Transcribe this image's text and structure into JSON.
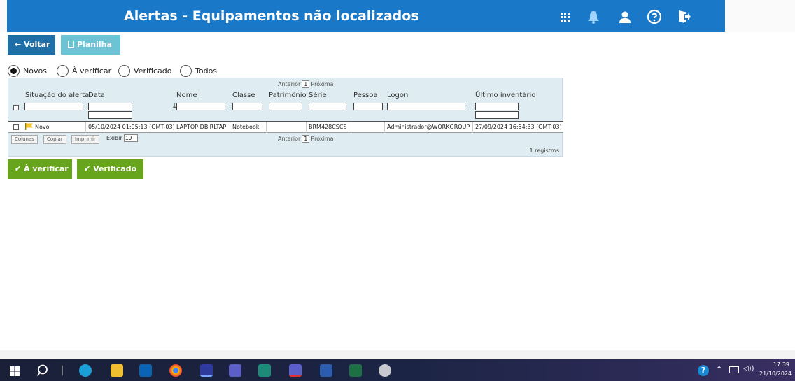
{
  "header": {
    "title": "Alertas - Equipamentos não localizados",
    "bar_color": "#1978c8",
    "icons": [
      "apps-grid-icon",
      "bell-icon",
      "user-icon",
      "help-icon",
      "logout-icon"
    ]
  },
  "toolbar": {
    "back_label": "← Voltar",
    "spreadsheet_label": "Planilha"
  },
  "filters": {
    "options": [
      "Novos",
      "À verificar",
      "Verificado",
      "Todos"
    ],
    "selected": "Novos"
  },
  "grid": {
    "pager": {
      "prev": "Anterior",
      "page": "1",
      "next": "Próxima"
    },
    "columns": [
      "Situação do alerta",
      "Data",
      "Nome",
      "Classe",
      "Patrimônio",
      "Série",
      "Pessoa",
      "Logon",
      "Último inventário"
    ],
    "sort_indicator": "↓",
    "rows": [
      {
        "status": "Novo",
        "data": "05/10/2024 01:05:13 (GMT-03)",
        "nome": "LAPTOP-DBIRLTAP",
        "classe": "Notebook",
        "patrimonio": "",
        "serie": "BRM428CSCS",
        "pessoa": "",
        "logon": "Administrador@WORKGROUP",
        "ultimo_inventario": "27/09/2024 16:54:33 (GMT-03)"
      }
    ],
    "buttons": {
      "colunas": "Colunas",
      "copiar": "Copiar",
      "imprimir": "Imprimir"
    },
    "exibir_label": "Exibir",
    "exibir_value": "10",
    "records": "1 registros"
  },
  "actions": {
    "verify_label": "À verificar",
    "verified_label": "Verificado",
    "color": "#67a51c"
  },
  "taskbar": {
    "time": "17:39",
    "date": "21/10/2024"
  }
}
